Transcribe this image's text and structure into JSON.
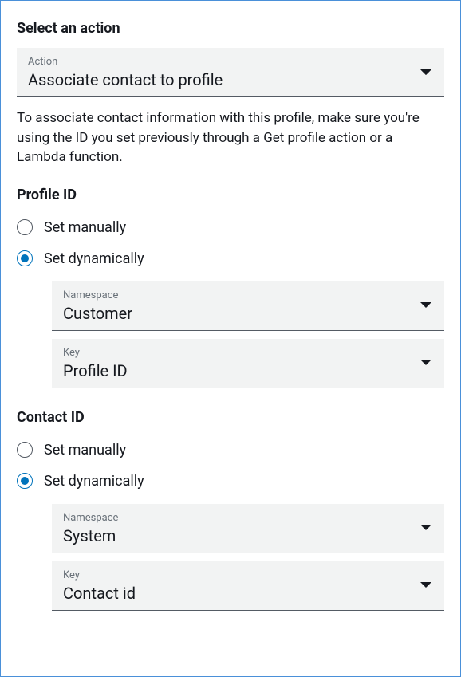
{
  "sectionTitle": "Select an action",
  "action": {
    "label": "Action",
    "value": "Associate contact to profile"
  },
  "helpText": "To associate contact information with this profile, make sure you're using the ID you set previously through a Get profile action or a Lambda function.",
  "profileId": {
    "heading": "Profile ID",
    "manualLabel": "Set manually",
    "dynamicLabel": "Set dynamically",
    "selected": "dynamic",
    "namespace": {
      "label": "Namespace",
      "value": "Customer"
    },
    "key": {
      "label": "Key",
      "value": "Profile ID"
    }
  },
  "contactId": {
    "heading": "Contact ID",
    "manualLabel": "Set manually",
    "dynamicLabel": "Set dynamically",
    "selected": "dynamic",
    "namespace": {
      "label": "Namespace",
      "value": "System"
    },
    "key": {
      "label": "Key",
      "value": "Contact id"
    }
  }
}
